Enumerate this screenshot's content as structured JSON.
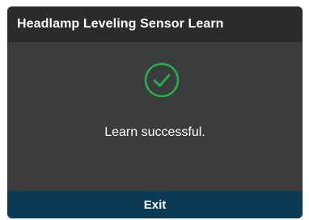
{
  "dialog": {
    "title": "Headlamp Leveling Sensor Learn",
    "status_icon": "check-circle-icon",
    "message": "Learn successful.",
    "exit_label": "Exit"
  },
  "colors": {
    "background": "#3a3c3d",
    "title_bar": "#2a2b2c",
    "success": "#23b14a",
    "footer": "#0b3a56",
    "text": "#ffffff"
  }
}
